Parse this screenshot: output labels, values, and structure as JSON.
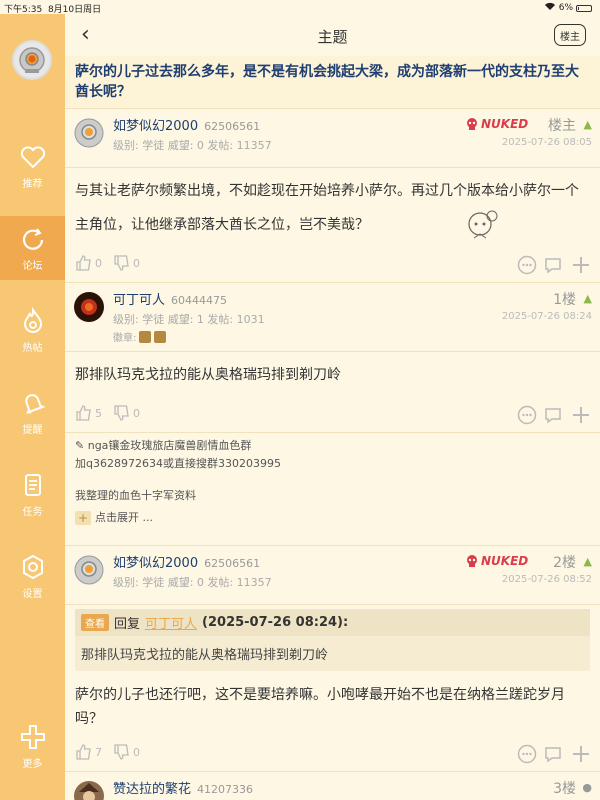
{
  "status": {
    "time": "下午5:35",
    "date": "8月10日周日",
    "battery": "6%",
    "battery_level": 0.06
  },
  "sidebar": {
    "items": [
      {
        "label": "推荐",
        "icon": "heart-icon"
      },
      {
        "label": "论坛",
        "icon": "forum-swirl-icon",
        "active": true
      },
      {
        "label": "热帖",
        "icon": "flame-icon"
      },
      {
        "label": "提醒",
        "icon": "bell-icon"
      },
      {
        "label": "任务",
        "icon": "task-list-icon"
      },
      {
        "label": "设置",
        "icon": "gear-icon"
      },
      {
        "label": "更多",
        "icon": "plus-icon"
      }
    ]
  },
  "header": {
    "back_icon": "‹",
    "title": "主题",
    "louzhu_button": "楼主"
  },
  "topic": {
    "title": "萨尔的儿子过去那么多年，是不是有机会挑起大梁，成为部落新一代的支柱乃至大酋长呢？"
  },
  "posts": [
    {
      "name": "如梦似幻2000",
      "uid": "62506561",
      "meta": "级别: 学徒  威望: 0  发帖: 11357",
      "floor": "楼主",
      "time": "2025-07-26 08:05",
      "nuked": "NUKED",
      "body": "与其让老萨尔频繁出境，不如趁现在开始培养小萨尔。再过几个版本给小萨尔一个主角位，让他继承部落大酋长之位，岂不美哉？",
      "likes": "0",
      "dislikes": "0"
    },
    {
      "name": "可丁可人",
      "uid": "60444475",
      "meta": "级别: 学徒  威望: 1  发帖: 1031",
      "badge_label": "徽章:",
      "floor": "1楼",
      "time": "2025-07-26 08:24",
      "body": "那排队玛克戈拉的能从奥格瑞玛排到剃刀岭",
      "likes": "5",
      "dislikes": "0",
      "signature": {
        "line1": "nga镶金玫瑰旅店魔兽剧情血色群",
        "line2": "加q3628972634或直接搜群330203995",
        "line3": "我整理的血色十字军资料",
        "expand": "点击展开 ..."
      }
    },
    {
      "name": "如梦似幻2000",
      "uid": "62506561",
      "meta": "级别: 学徒  威望: 0  发帖: 11357",
      "floor": "2楼",
      "time": "2025-07-26 08:52",
      "nuked": "NUKED",
      "quote": {
        "tag": "查看",
        "reply": "回复",
        "user": "可丁可人",
        "when": "(2025-07-26 08:24):",
        "text": "那排队玛克戈拉的能从奥格瑞玛排到剃刀岭"
      },
      "body": "萨尔的儿子也还行吧，这不是要培养嘛。小咆哮最开始不也是在纳格兰蹉跎岁月吗？",
      "likes": "7",
      "dislikes": "0"
    },
    {
      "name": "赞达拉的繁花",
      "uid": "41207336",
      "floor": "3楼"
    }
  ],
  "colors": {
    "sidebar": "#f7c774",
    "sidebar_active": "#f0a94e",
    "background": "#fdf7e4",
    "title": "#1f3f72",
    "nuked": "#d93d4c"
  }
}
